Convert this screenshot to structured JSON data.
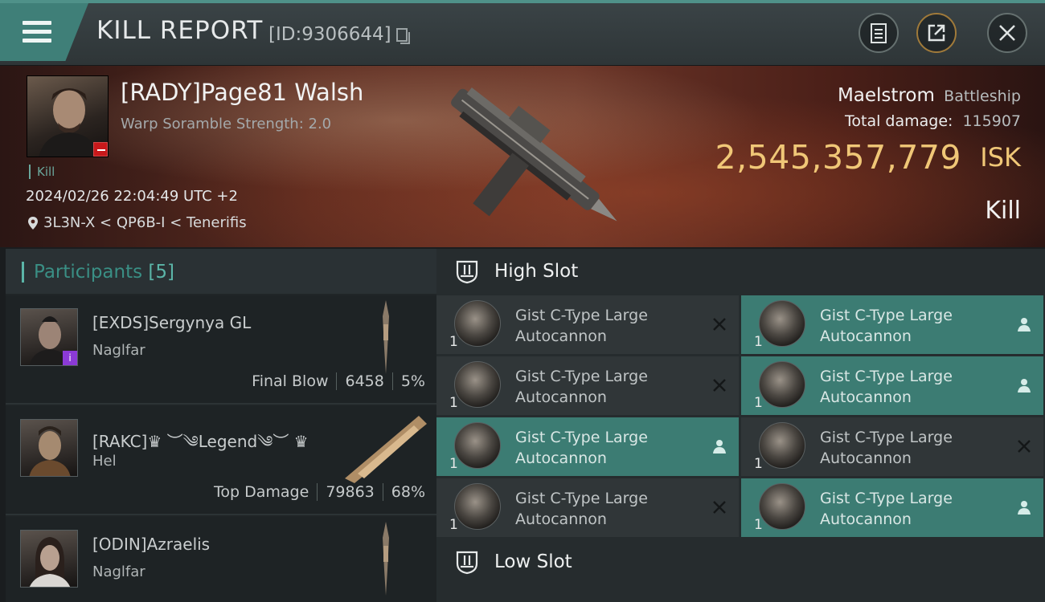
{
  "header": {
    "title": "KILL REPORT",
    "report_id": "[ID:9306644]",
    "icons": [
      "menu-icon",
      "copy-icon",
      "clipboard-icon",
      "share-icon",
      "close-icon"
    ]
  },
  "victim": {
    "name": "[RADY]Page81 Walsh",
    "scramble": "Warp Soramble Strength: 2.0",
    "kill_tag": "Kill",
    "timestamp": "2024/02/26 22:04:49 UTC +2",
    "location": "3L3N-X < QP6B-I < Tenerifis",
    "ship_name": "Maelstrom",
    "ship_class": "Battleship",
    "total_damage_label": "Total damage:",
    "total_damage_value": "115907",
    "isk_value": "2,545,357,779",
    "isk_unit": "ISK",
    "result": "Kill"
  },
  "participants": {
    "label": "Participants",
    "count": "[5]",
    "rows": [
      {
        "name": "[EXDS]Sergynya GL",
        "ship": "Naglfar",
        "role": "Final Blow",
        "damage": "6458",
        "percent": "5%"
      },
      {
        "name": "[RAKC]♛ ︶༄Legend༄︶ ♛",
        "ship": "Hel",
        "role": "Top Damage",
        "damage": "79863",
        "percent": "68%"
      },
      {
        "name": "[ODIN]Azraelis",
        "ship": "Naglfar"
      }
    ]
  },
  "slots": {
    "high_label": "High Slot",
    "low_label": "Low Slot",
    "high_modules": [
      {
        "name1": "Gist C-Type Large",
        "name2": "Autocannon",
        "qty": "1",
        "state": "destroyed"
      },
      {
        "name1": "Gist C-Type Large",
        "name2": "Autocannon",
        "qty": "1",
        "state": "dropped"
      },
      {
        "name1": "Gist C-Type Large",
        "name2": "Autocannon",
        "qty": "1",
        "state": "destroyed"
      },
      {
        "name1": "Gist C-Type Large",
        "name2": "Autocannon",
        "qty": "1",
        "state": "dropped"
      },
      {
        "name1": "Gist C-Type Large",
        "name2": "Autocannon",
        "qty": "1",
        "state": "dropped"
      },
      {
        "name1": "Gist C-Type Large",
        "name2": "Autocannon",
        "qty": "1",
        "state": "destroyed"
      },
      {
        "name1": "Gist C-Type Large",
        "name2": "Autocannon",
        "qty": "1",
        "state": "destroyed"
      },
      {
        "name1": "Gist C-Type Large",
        "name2": "Autocannon",
        "qty": "1",
        "state": "dropped"
      }
    ]
  },
  "colors": {
    "accent_teal": "#3c7c73",
    "isk_gold": "#f0c777",
    "badge_red": "#c8191b"
  }
}
